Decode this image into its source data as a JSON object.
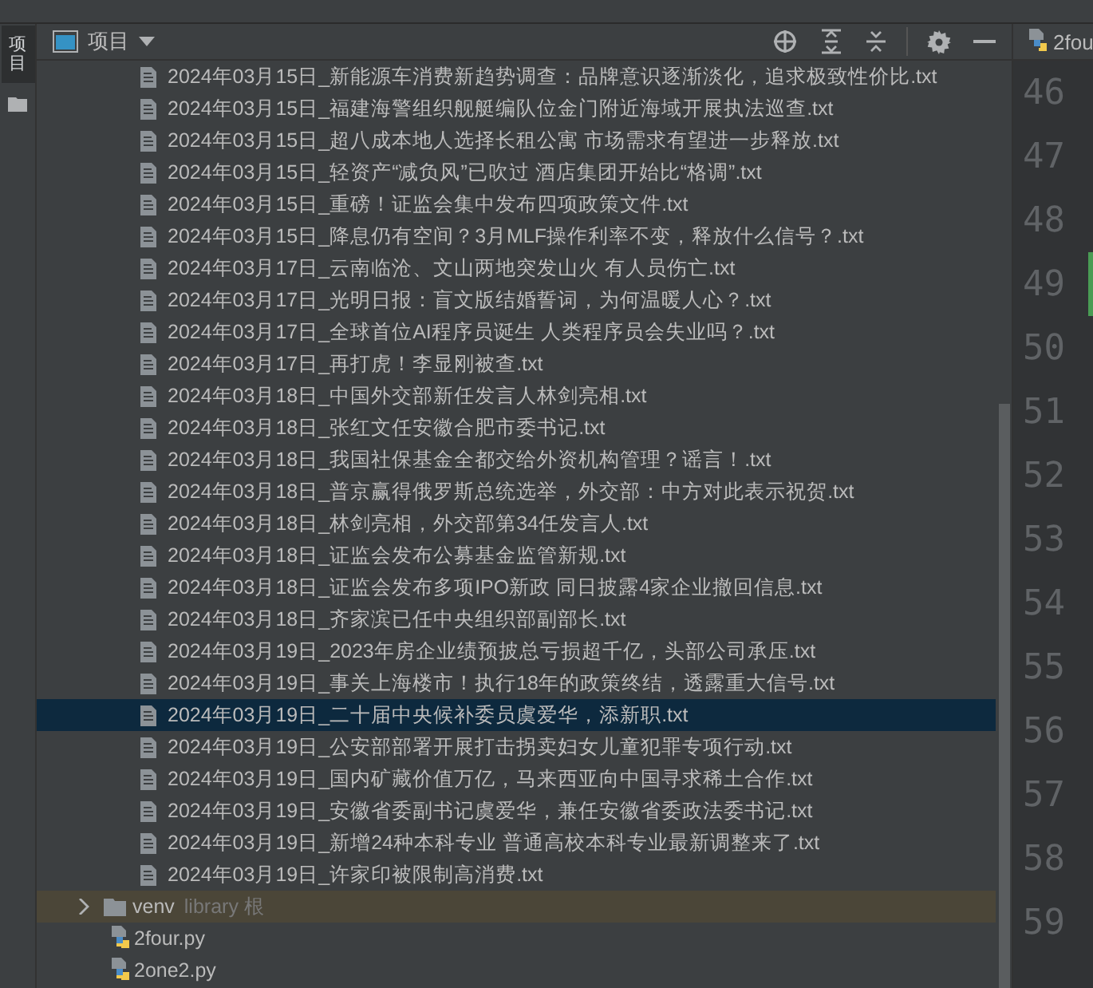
{
  "side_strip": {
    "label": "项目"
  },
  "panel": {
    "title": "项目",
    "tools": [
      {
        "kind": "locate"
      },
      {
        "kind": "expand"
      },
      {
        "kind": "collapse"
      },
      {
        "kind": "settings"
      },
      {
        "kind": "hide"
      }
    ]
  },
  "tree": {
    "children_of_folder_above": [
      {
        "name": "2024年03月15日_新能源车消费新趋势调查：品牌意识逐渐淡化，追求极致性价比.txt",
        "selected": false
      },
      {
        "name": "2024年03月15日_福建海警组织舰艇编队位金门附近海域开展执法巡查.txt",
        "selected": false
      },
      {
        "name": "2024年03月15日_超八成本地人选择长租公寓 市场需求有望进一步释放.txt",
        "selected": false
      },
      {
        "name": "2024年03月15日_轻资产“减负风”已吹过 酒店集团开始比“格调”.txt",
        "selected": false
      },
      {
        "name": "2024年03月15日_重磅！证监会集中发布四项政策文件.txt",
        "selected": false
      },
      {
        "name": "2024年03月15日_降息仍有空间？3月MLF操作利率不变，释放什么信号？.txt",
        "selected": false
      },
      {
        "name": "2024年03月17日_云南临沧、文山两地突发山火 有人员伤亡.txt",
        "selected": false
      },
      {
        "name": "2024年03月17日_光明日报：盲文版结婚誓词，为何温暖人心？.txt",
        "selected": false
      },
      {
        "name": "2024年03月17日_全球首位AI程序员诞生 人类程序员会失业吗？.txt",
        "selected": false
      },
      {
        "name": "2024年03月17日_再打虎！李显刚被查.txt",
        "selected": false
      },
      {
        "name": "2024年03月18日_中国外交部新任发言人林剑亮相.txt",
        "selected": false
      },
      {
        "name": "2024年03月18日_张红文任安徽合肥市委书记.txt",
        "selected": false
      },
      {
        "name": "2024年03月18日_我国社保基金全都交给外资机构管理？谣言！.txt",
        "selected": false
      },
      {
        "name": "2024年03月18日_普京赢得俄罗斯总统选举，外交部：中方对此表示祝贺.txt",
        "selected": false
      },
      {
        "name": "2024年03月18日_林剑亮相，外交部第34任发言人.txt",
        "selected": false
      },
      {
        "name": "2024年03月18日_证监会发布公募基金监管新规.txt",
        "selected": false
      },
      {
        "name": "2024年03月18日_证监会发布多项IPO新政 同日披露4家企业撤回信息.txt",
        "selected": false
      },
      {
        "name": "2024年03月18日_齐家滨已任中央组织部副部长.txt",
        "selected": false
      },
      {
        "name": "2024年03月19日_2023年房企业绩预披总亏损超千亿，头部公司承压.txt",
        "selected": false
      },
      {
        "name": "2024年03月19日_事关上海楼市！执行18年的政策终结，透露重大信号.txt",
        "selected": false
      },
      {
        "name": "2024年03月19日_二十届中央候补委员虞爱华，添新职.txt",
        "selected": true
      },
      {
        "name": "2024年03月19日_公安部部署开展打击拐卖妇女儿童犯罪专项行动.txt",
        "selected": false
      },
      {
        "name": "2024年03月19日_国内矿藏价值万亿，马来西亚向中国寻求稀土合作.txt",
        "selected": false
      },
      {
        "name": "2024年03月19日_安徽省委副书记虞爱华，兼任安徽省委政法委书记.txt",
        "selected": false
      },
      {
        "name": "2024年03月19日_新增24种本科专业 普通高校本科专业最新调整来了.txt",
        "selected": false
      },
      {
        "name": "2024年03月19日_许家印被限制高消费.txt",
        "selected": false
      }
    ],
    "items": [
      {
        "kind": "folder",
        "name": "venv",
        "note": "library 根",
        "expanded": false,
        "highlighted": true
      },
      {
        "kind": "python",
        "name": "2four.py",
        "highlighted": false
      },
      {
        "kind": "python",
        "name": "2one2.py",
        "highlighted": false
      }
    ]
  },
  "editor": {
    "tab": "2fou",
    "line_numbers": [
      {
        "number": "46",
        "changed": false
      },
      {
        "number": "47",
        "changed": false
      },
      {
        "number": "48",
        "changed": false
      },
      {
        "number": "49",
        "changed": true
      },
      {
        "number": "50",
        "changed": false
      },
      {
        "number": "51",
        "changed": false
      },
      {
        "number": "52",
        "changed": false
      },
      {
        "number": "53",
        "changed": false
      },
      {
        "number": "54",
        "changed": false
      },
      {
        "number": "55",
        "changed": false
      },
      {
        "number": "56",
        "changed": false
      },
      {
        "number": "57",
        "changed": false
      },
      {
        "number": "58",
        "changed": false
      },
      {
        "number": "59",
        "changed": false
      }
    ]
  }
}
